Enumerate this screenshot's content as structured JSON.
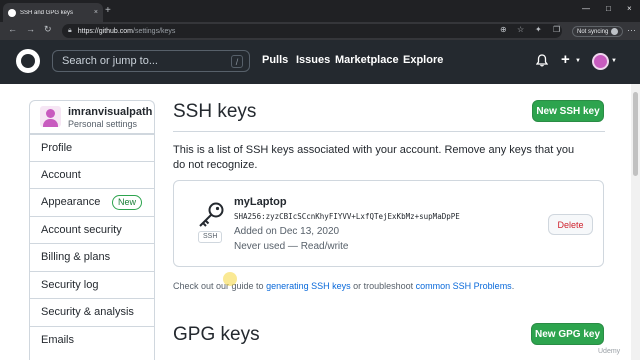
{
  "browser": {
    "tab_title": "SSH and GPG keys",
    "tab_close": "×",
    "new_tab": "+",
    "url_host": "https://github.com",
    "url_path": "/settings/keys",
    "sync_label": "Not syncing",
    "window_controls": [
      "—",
      "□",
      "×"
    ]
  },
  "header": {
    "search_placeholder": "Search or jump to...",
    "search_shortcut": "/",
    "nav": [
      "Pulls",
      "Issues",
      "Marketplace",
      "Explore"
    ],
    "create_icon": "+"
  },
  "profile": {
    "username": "imranvisualpath",
    "subtitle": "Personal settings"
  },
  "sidebar": {
    "items": [
      {
        "label": "Profile",
        "badge": ""
      },
      {
        "label": "Account",
        "badge": ""
      },
      {
        "label": "Appearance",
        "badge": "New"
      },
      {
        "label": "Account security",
        "badge": ""
      },
      {
        "label": "Billing & plans",
        "badge": ""
      },
      {
        "label": "Security log",
        "badge": ""
      },
      {
        "label": "Security & analysis",
        "badge": ""
      },
      {
        "label": "Emails",
        "badge": ""
      }
    ]
  },
  "ssh": {
    "title": "SSH keys",
    "new_button": "New SSH key",
    "description": "This is a list of SSH keys associated with your account. Remove any keys that you do not recognize.",
    "key": {
      "name": "myLaptop",
      "fingerprint": "SHA256:zyzCBIcSCcnKhyFIYVV+LxfQTejExKbMz+supMaDpPE",
      "type_label": "SSH",
      "added": "Added on Dec 13, 2020",
      "usage": "Never used — Read/write",
      "delete_label": "Delete"
    },
    "helper_prefix": "Check out our guide to ",
    "helper_link1": "generating SSH keys",
    "helper_middle": " or troubleshoot ",
    "helper_link2": "common SSH Problems",
    "helper_suffix": "."
  },
  "gpg": {
    "title": "GPG keys",
    "new_button": "New GPG key"
  },
  "watermark": "Udemy",
  "colors": {
    "primary_button": "#2da44e",
    "danger": "#cf222e",
    "link": "#0969da",
    "header_bg": "#24292f"
  }
}
